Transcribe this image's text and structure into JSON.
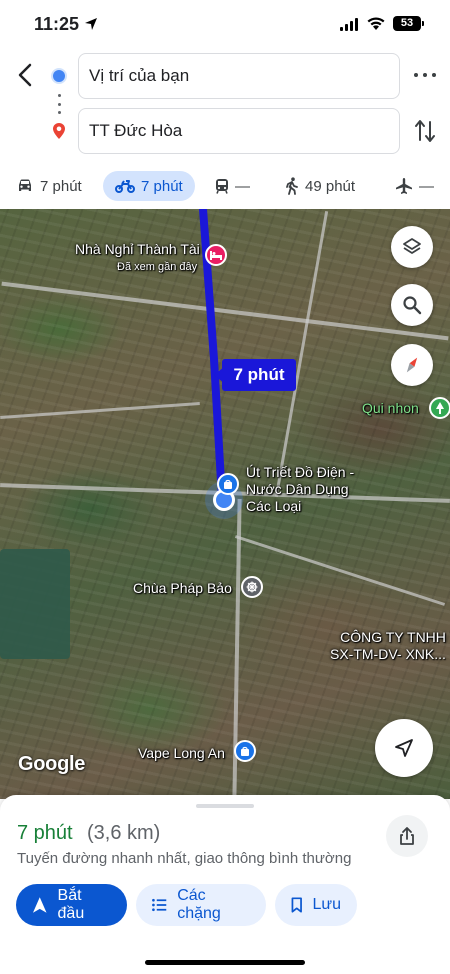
{
  "status_bar": {
    "time": "11:25",
    "battery": "53"
  },
  "route": {
    "origin": "Vị trí của bạn",
    "destination": "TT Đức Hòa"
  },
  "modes": [
    {
      "name": "car",
      "icon": "car-icon",
      "label": "7 phút"
    },
    {
      "name": "motorbike",
      "icon": "motorbike-icon",
      "label": "7 phút",
      "active": true
    },
    {
      "name": "transit",
      "icon": "transit-icon",
      "label": "—"
    },
    {
      "name": "walk",
      "icon": "walk-icon",
      "label": "49 phút"
    },
    {
      "name": "flight",
      "icon": "flight-icon",
      "label": "—"
    }
  ],
  "map": {
    "route_callout": "7 phút",
    "labels": {
      "hotel": "Nhà Nghỉ Thành Tài",
      "hotel_sub": "Đã xem gần đây",
      "store": "Út Triết Đồ Điện -\nNước Dân Dụng\nCác Loại",
      "pagoda": "Chùa Pháp Bảo",
      "park": "Qui nhon",
      "company": "CÔNG TY TNHH\nSX-TM-DV- XNK...",
      "vape": "Vape Long An"
    },
    "logo": "Google",
    "accent": "#1a17d9"
  },
  "sheet": {
    "duration": "7 phút",
    "distance": "(3,6 km)",
    "description": "Tuyến đường nhanh nhất, giao thông bình thường",
    "start_label": "Bắt đầu",
    "steps_label": "Các chặng",
    "save_label": "Lưu",
    "primary_color": "#0b57d0",
    "duration_color": "#188038"
  }
}
